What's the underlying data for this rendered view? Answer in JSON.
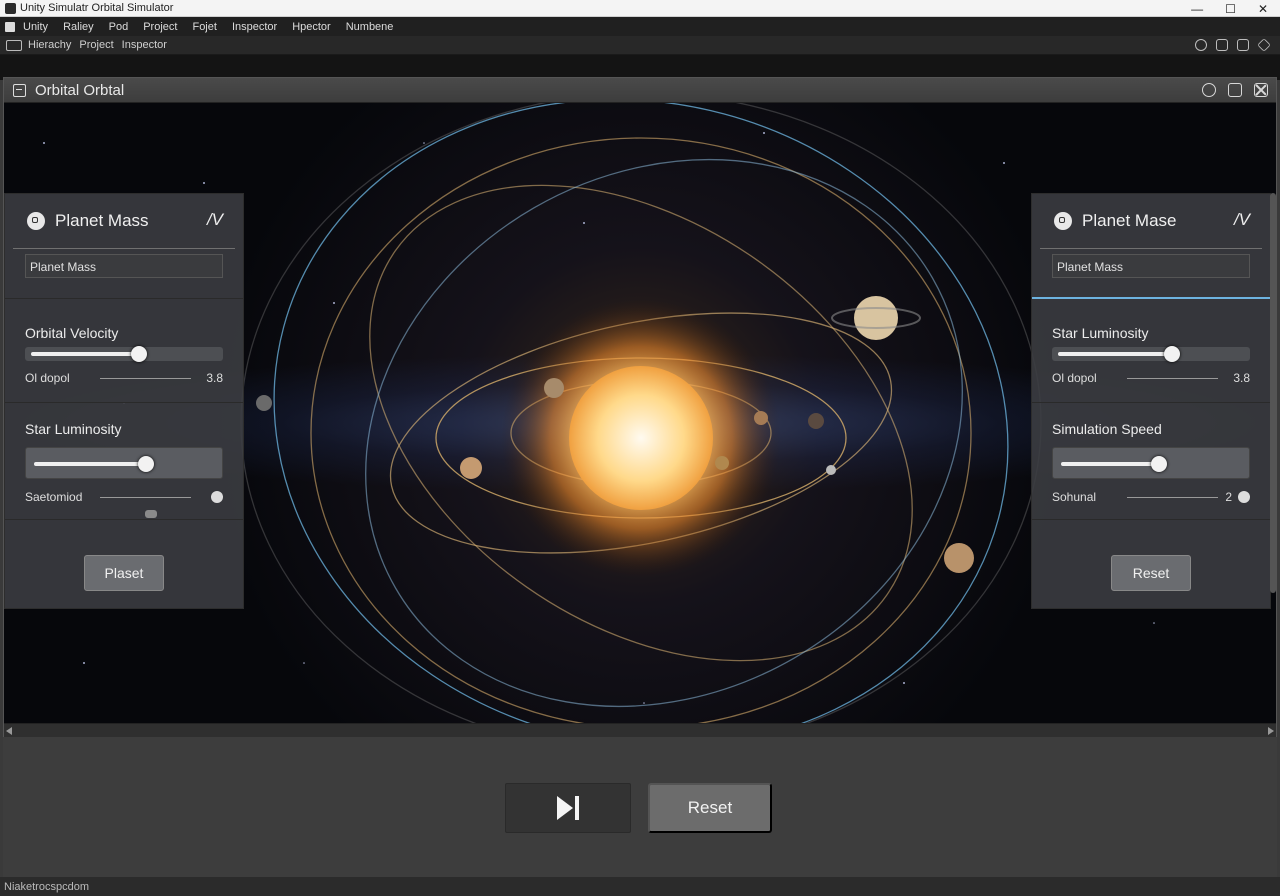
{
  "window": {
    "title": "Unity Simulatr Orbital Simulator"
  },
  "menubar": {
    "items": [
      "Unity",
      "Raliey",
      "Pod",
      "Project",
      "Fojet",
      "Inspector",
      "Hpector",
      "Numbene"
    ]
  },
  "toolbar": {
    "items": [
      "Hierachy",
      "Project",
      "Inspector"
    ]
  },
  "sim": {
    "title": "Orbital Orbtal",
    "left_panel": {
      "header": "Planet Mass",
      "field": "Planet Mass",
      "section2_label": "Orbital Velocity",
      "section2_value": 0.57,
      "section2_sub": "Ol dopol",
      "section2_sub_value": "3.8",
      "section3_label": "Star Luminosity",
      "section3_value": 0.6,
      "section3_sub": "Saetomiod",
      "button": "Plaset"
    },
    "right_panel": {
      "header": "Planet Mase",
      "field": "Planet Mass",
      "section2_label": "Star Luminosity",
      "section2_value": 0.6,
      "section2_sub": "Ol dopol",
      "section2_sub_value": "3.8",
      "section3_label": "Simulation Speed",
      "section3_value": 0.52,
      "section3_sub": "Sohunal",
      "section3_sub_value": "2",
      "button": "Reset"
    }
  },
  "bottom": {
    "reset_label": "Reset"
  },
  "status": {
    "text": "Niaketrocspcdom"
  }
}
